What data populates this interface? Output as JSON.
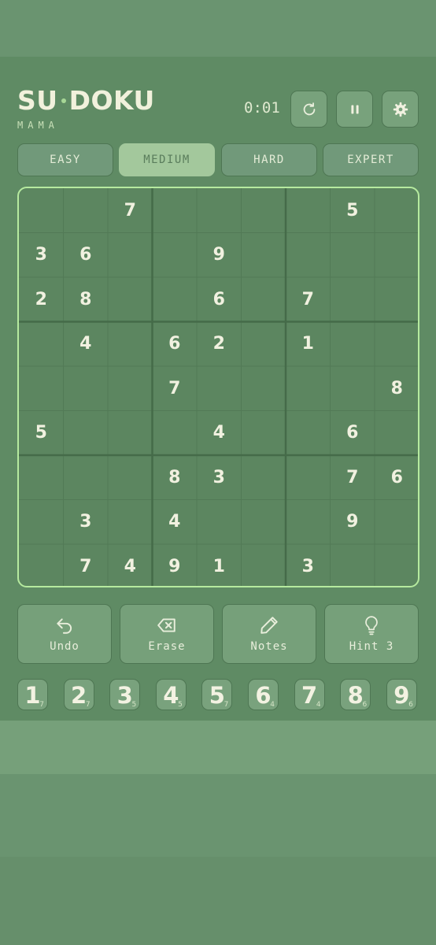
{
  "app": {
    "title": "SU DOKU",
    "title_left": "SU",
    "title_right": "DOKU",
    "subtitle": "MAMA"
  },
  "timer": "0:01",
  "header_icons": [
    "restart-icon",
    "pause-icon",
    "gear-icon"
  ],
  "difficulty": {
    "options": [
      "EASY",
      "MEDIUM",
      "HARD",
      "EXPERT"
    ],
    "selected": "MEDIUM"
  },
  "board": [
    [
      0,
      0,
      7,
      0,
      0,
      0,
      0,
      5,
      0
    ],
    [
      3,
      6,
      0,
      0,
      9,
      0,
      0,
      0,
      0
    ],
    [
      2,
      8,
      0,
      0,
      6,
      0,
      7,
      0,
      0
    ],
    [
      0,
      4,
      0,
      6,
      2,
      0,
      1,
      0,
      0
    ],
    [
      0,
      0,
      0,
      7,
      0,
      0,
      0,
      0,
      8
    ],
    [
      5,
      0,
      0,
      0,
      4,
      0,
      0,
      6,
      0
    ],
    [
      0,
      0,
      0,
      8,
      3,
      0,
      0,
      7,
      6
    ],
    [
      0,
      3,
      0,
      4,
      0,
      0,
      0,
      9,
      0
    ],
    [
      0,
      7,
      4,
      9,
      1,
      0,
      3,
      0,
      0
    ]
  ],
  "actions": [
    {
      "label": "Undo",
      "icon": "undo-icon"
    },
    {
      "label": "Erase",
      "icon": "erase-icon"
    },
    {
      "label": "Notes",
      "icon": "pencil-icon"
    },
    {
      "label": "Hint 3",
      "icon": "lightbulb-icon"
    }
  ],
  "numpad": [
    {
      "digit": "1",
      "remaining": "7"
    },
    {
      "digit": "2",
      "remaining": "7"
    },
    {
      "digit": "3",
      "remaining": "5"
    },
    {
      "digit": "4",
      "remaining": "5"
    },
    {
      "digit": "5",
      "remaining": "7"
    },
    {
      "digit": "6",
      "remaining": "4"
    },
    {
      "digit": "7",
      "remaining": "4"
    },
    {
      "digit": "8",
      "remaining": "6"
    },
    {
      "digit": "9",
      "remaining": "6"
    }
  ],
  "colors": {
    "background": "#5f8b64",
    "accent": "#b6ea9f",
    "selected_tab": "#a3c89c",
    "button": "#76a07a",
    "digit": "#f1f1e0"
  }
}
